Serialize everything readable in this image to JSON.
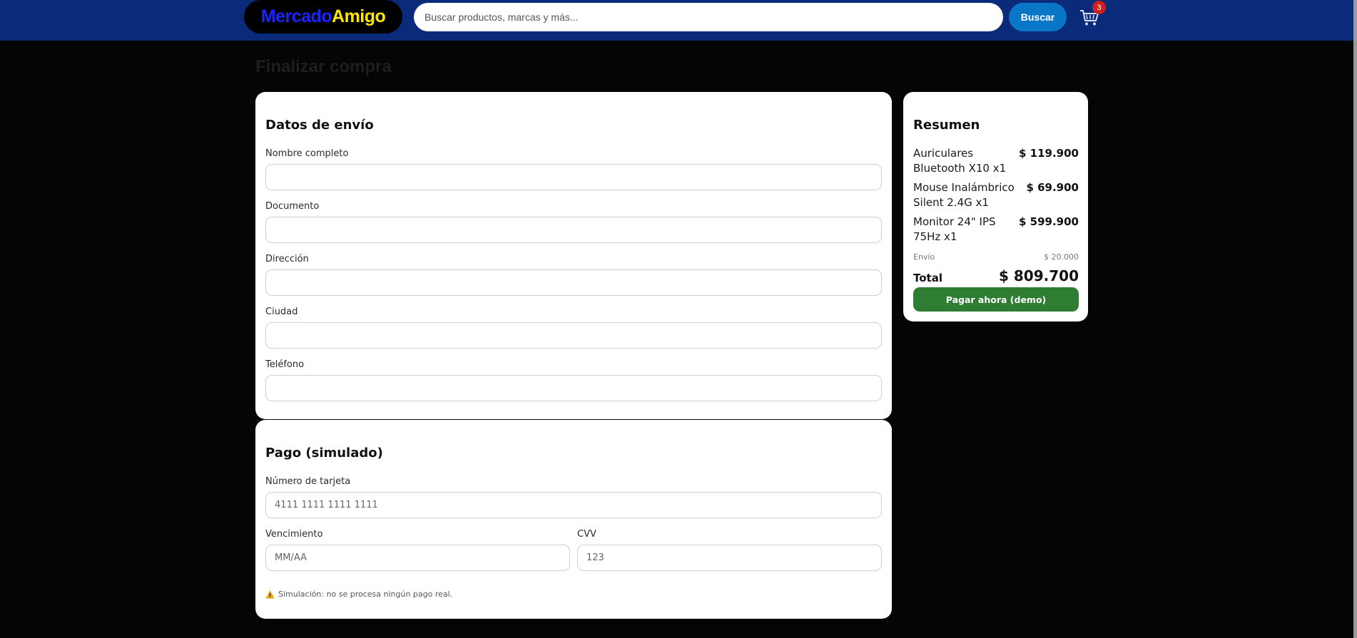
{
  "header": {
    "logo_part1": "Mercado",
    "logo_part2": "Amigo",
    "search_placeholder": "Buscar productos, marcas y más...",
    "search_button": "Buscar",
    "cart_count": "3"
  },
  "page_title": "Finalizar compra",
  "shipping": {
    "title": "Datos de envío",
    "fields": [
      {
        "label": "Nombre completo",
        "value": ""
      },
      {
        "label": "Documento",
        "value": ""
      },
      {
        "label": "Dirección",
        "value": ""
      },
      {
        "label": "Ciudad",
        "value": ""
      },
      {
        "label": "Teléfono",
        "value": ""
      }
    ]
  },
  "payment": {
    "title": "Pago (simulado)",
    "card_number": {
      "label": "Número de tarjeta",
      "placeholder": "4111 1111 1111 1111"
    },
    "expiry": {
      "label": "Vencimiento",
      "placeholder": "MM/AA"
    },
    "cvv": {
      "label": "CVV",
      "placeholder": "123"
    },
    "note": "Simulación: no se procesa ningún pago real."
  },
  "summary": {
    "title": "Resumen",
    "items": [
      {
        "name": "Auriculares Bluetooth X10 x1",
        "price": "$ 119.900"
      },
      {
        "name": "Mouse Inalámbrico Silent 2.4G x1",
        "price": "$ 69.900"
      },
      {
        "name": "Monitor 24\" IPS 75Hz x1",
        "price": "$ 599.900"
      }
    ],
    "shipping_label": "Envío",
    "shipping_value": "$ 20.000",
    "total_label": "Total",
    "total_value": "$ 809.700",
    "pay_button": "Pagar ahora (demo)"
  },
  "colors": {
    "header_bg": "#0a2a7a",
    "page_bg": "#050505",
    "search_button": "#0a76c8",
    "pay_button": "#2e7d32",
    "badge": "#d11f1f",
    "logo_blue": "#1a24ff",
    "logo_yellow": "#ffe600"
  },
  "icons": {
    "cart": "shopping-cart-icon",
    "warning": "warning-icon"
  }
}
